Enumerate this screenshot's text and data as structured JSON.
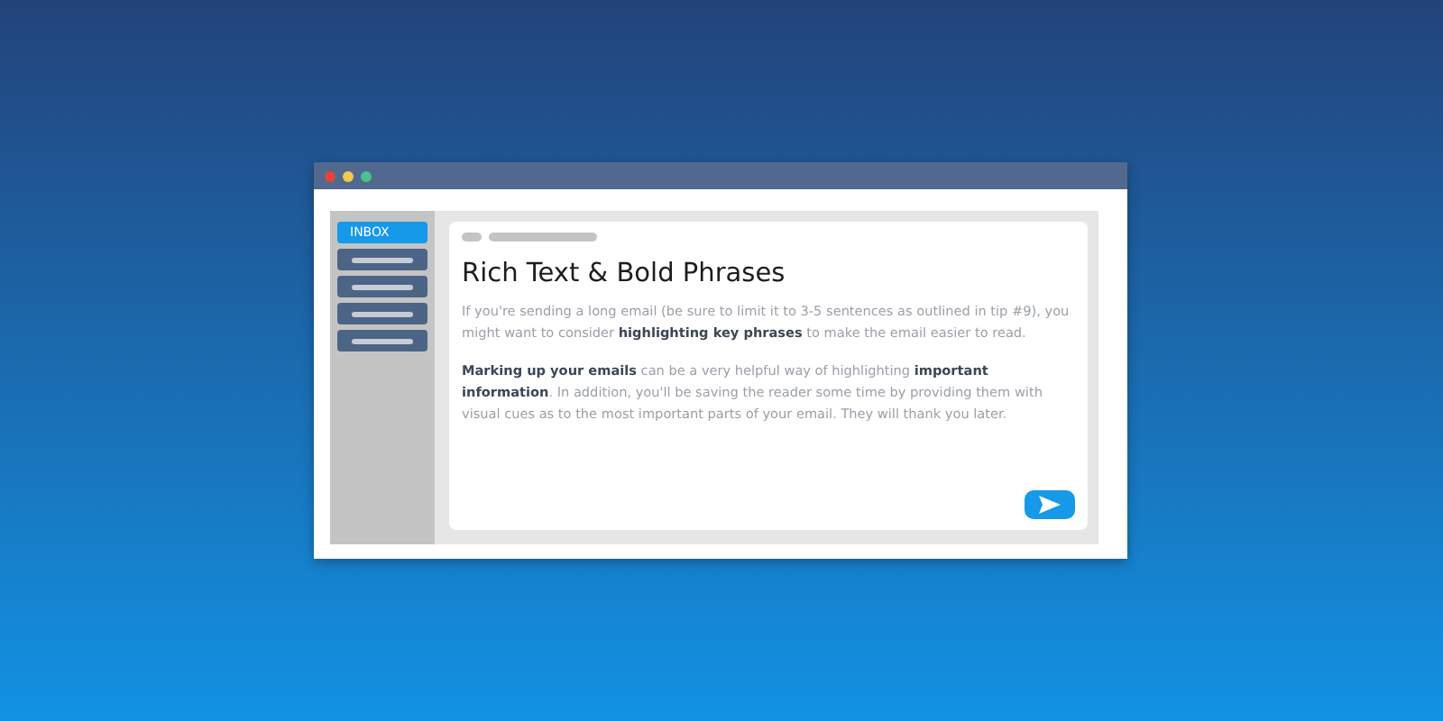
{
  "sidebar": {
    "items": [
      {
        "label": "INBOX",
        "selected": true
      },
      {
        "selected": false
      },
      {
        "selected": false
      },
      {
        "selected": false
      },
      {
        "selected": false
      }
    ]
  },
  "email": {
    "heading": "Rich Text & Bold Phrases",
    "paragraphs": [
      "If you're sending a long email (be sure to limit it to 3-5 sentences as outlined in tip #9), you might want to consider **highlighting key phrases** to make the email easier to read.",
      "**Marking up your emails** can be a very helpful way of highlighting **important information**. In addition, you'll be saving the reader some time by providing them with visual cues as to the most important parts of your email. They will thank you later."
    ]
  }
}
